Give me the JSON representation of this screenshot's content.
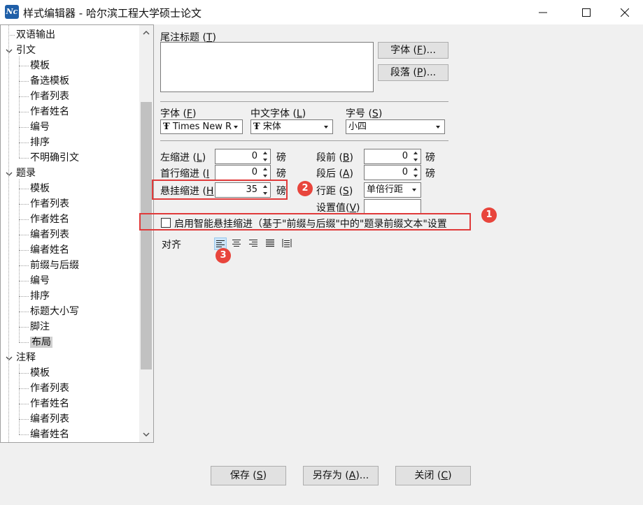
{
  "window": {
    "title": "样式编辑器 - 哈尔滨工程大学硕士论文",
    "icon_text": "Nc",
    "controls": [
      "minimize-icon",
      "maximize-icon",
      "close-icon"
    ]
  },
  "tree": {
    "items": [
      {
        "label": "双语输出",
        "level": 1,
        "expandable": false
      },
      {
        "label": "引文",
        "level": 0,
        "expandable": true
      },
      {
        "label": "模板",
        "level": 2
      },
      {
        "label": "备选模板",
        "level": 2
      },
      {
        "label": "作者列表",
        "level": 2
      },
      {
        "label": "作者姓名",
        "level": 2
      },
      {
        "label": "编号",
        "level": 2
      },
      {
        "label": "排序",
        "level": 2
      },
      {
        "label": "不明确引文",
        "level": 2
      },
      {
        "label": "题录",
        "level": 0,
        "expandable": true
      },
      {
        "label": "模板",
        "level": 2
      },
      {
        "label": "作者列表",
        "level": 2
      },
      {
        "label": "作者姓名",
        "level": 2
      },
      {
        "label": "编者列表",
        "level": 2
      },
      {
        "label": "编者姓名",
        "level": 2
      },
      {
        "label": "前缀与后缀",
        "level": 2
      },
      {
        "label": "编号",
        "level": 2
      },
      {
        "label": "排序",
        "level": 2
      },
      {
        "label": "标题大小写",
        "level": 2
      },
      {
        "label": "脚注",
        "level": 2
      },
      {
        "label": "布局",
        "level": 2,
        "selected": true
      },
      {
        "label": "注释",
        "level": 0,
        "expandable": true
      },
      {
        "label": "模板",
        "level": 2
      },
      {
        "label": "作者列表",
        "level": 2
      },
      {
        "label": "作者姓名",
        "level": 2
      },
      {
        "label": "编者列表",
        "level": 2
      },
      {
        "label": "编者姓名",
        "level": 2
      }
    ]
  },
  "endnote": {
    "title_label": "尾注标题",
    "title_key": "T",
    "title_value": "",
    "font_btn": "字体",
    "font_btn_key": "F",
    "para_btn": "段落",
    "para_btn_key": "P"
  },
  "font_row": {
    "font_label": "字体",
    "font_key": "F",
    "font_value": "Times New R",
    "cn_font_label": "中文字体",
    "cn_font_key": "L",
    "cn_font_value": "宋体",
    "size_label": "字号",
    "size_key": "S",
    "size_value": "小四",
    "font_glyph": "Ŧ"
  },
  "indent": {
    "left_label": "左缩进",
    "left_key": "L",
    "left_value": "0",
    "first_label": "首行缩进",
    "first_key": "I",
    "first_value": "0",
    "hang_label": "悬挂缩进",
    "hang_key": "H",
    "hang_value": "35",
    "unit": "磅",
    "before_label": "段前",
    "before_key": "B",
    "before_value": "0",
    "after_label": "段后",
    "after_key": "A",
    "after_value": "0",
    "spacing_label": "行距",
    "spacing_key": "S",
    "spacing_value": "单倍行距",
    "setval_label": "设置值",
    "setval_key": "V",
    "setval_value": ""
  },
  "smart_hang": {
    "checked": false,
    "label": "启用智能悬挂缩进（基于\"前缀与后缀\"中的\"题录前缀文本\"设置"
  },
  "align": {
    "label": "对齐",
    "options": [
      "align-left-icon",
      "align-center-icon",
      "align-right-icon",
      "align-justify-icon",
      "align-distributed-icon"
    ],
    "selected": "align-left-icon"
  },
  "badges": [
    "1",
    "2",
    "3"
  ],
  "footer": {
    "save": "保存",
    "save_key": "S",
    "saveas": "另存为",
    "saveas_key": "A",
    "close": "关闭",
    "close_key": "C"
  },
  "colors": {
    "highlight_red": "#e03a3a",
    "badge_red": "#e8453c",
    "selection": "#cfcfcf"
  }
}
